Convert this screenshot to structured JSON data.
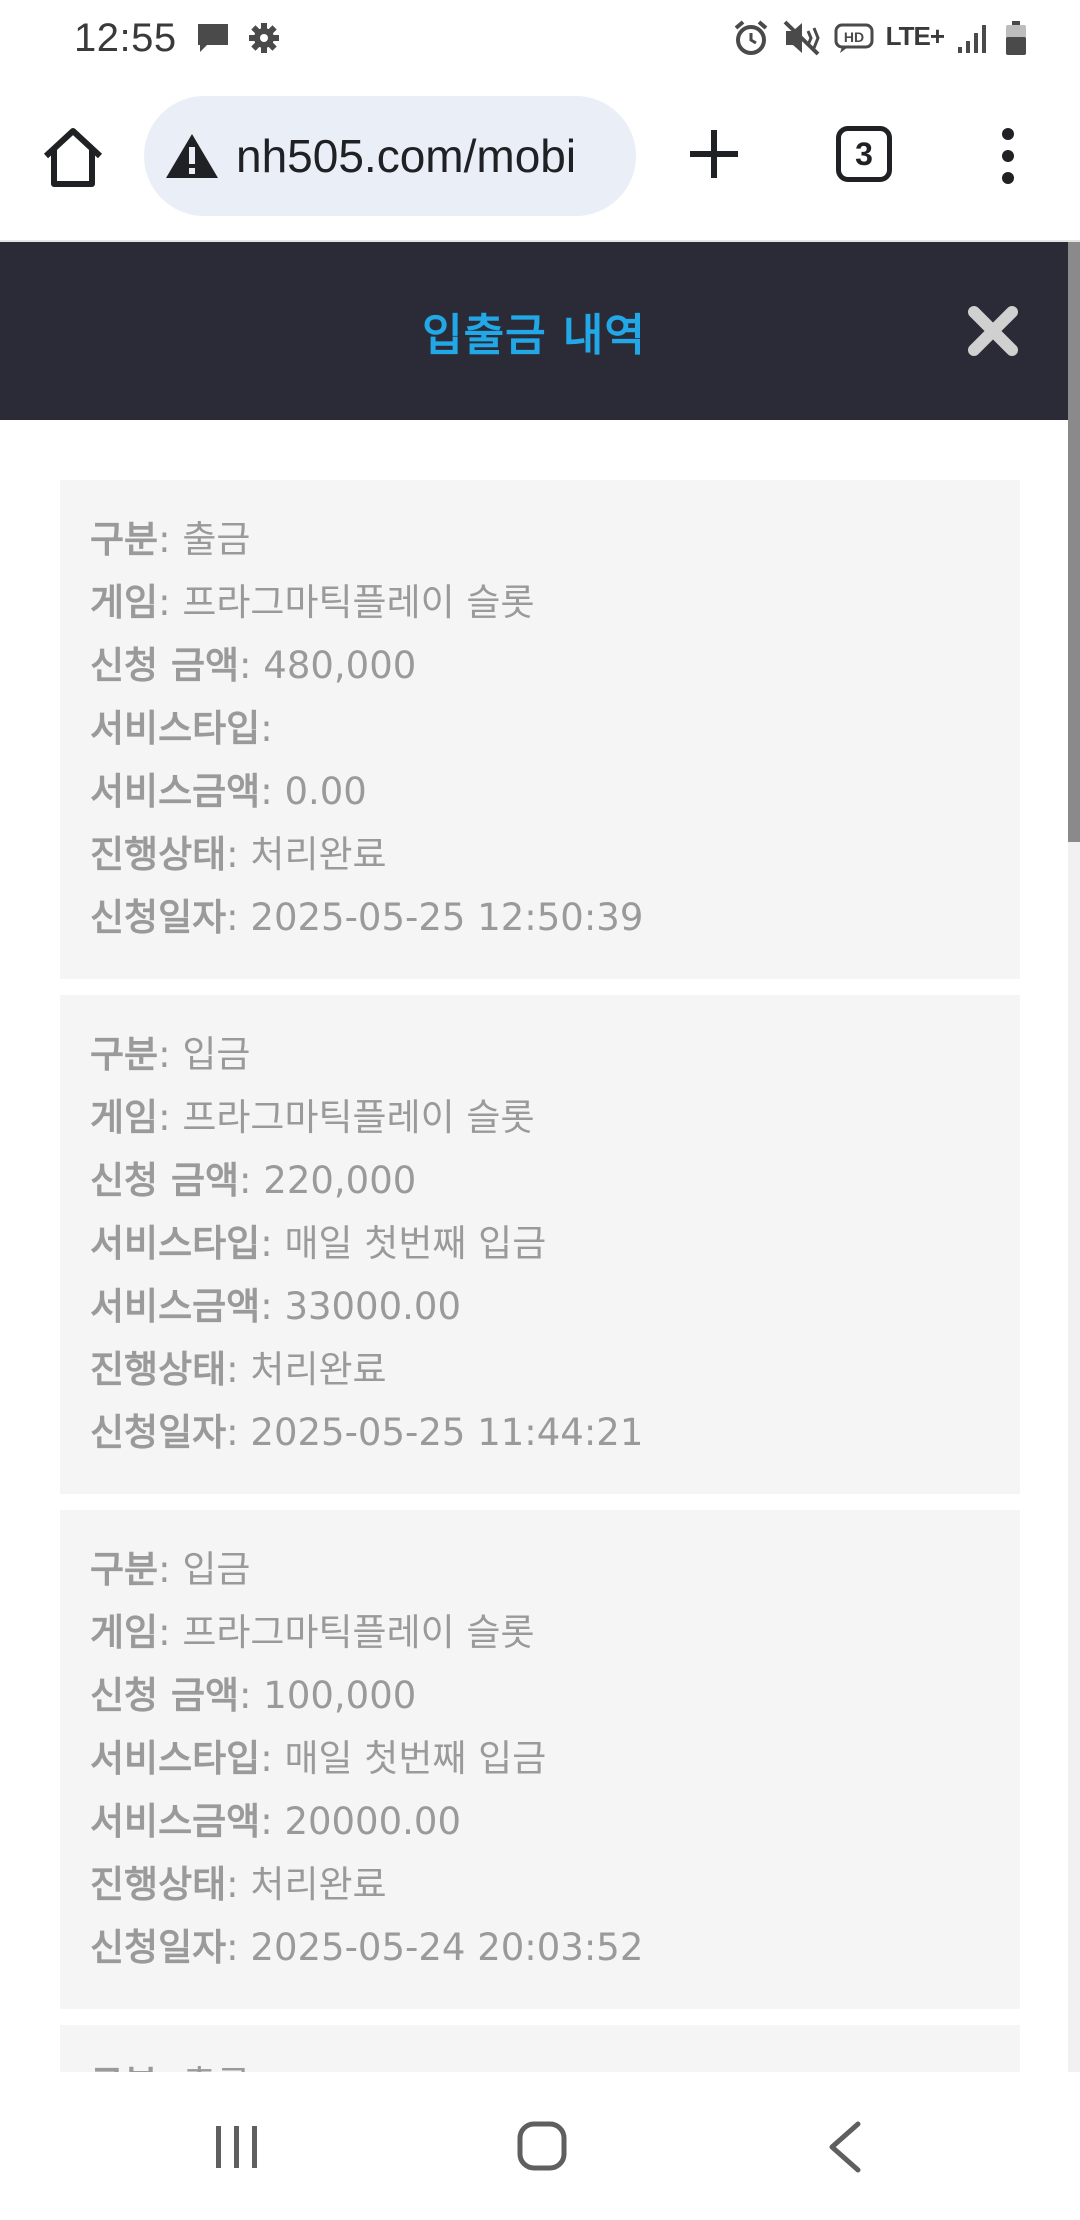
{
  "status_bar": {
    "time": "12:55",
    "network_label": "LTE+"
  },
  "browser": {
    "url": "nh505.com/mobi",
    "tab_count": "3"
  },
  "page": {
    "title": "입출금 내역"
  },
  "labels": {
    "type": "구분",
    "game": "게임",
    "amount": "신청 금액",
    "service_type": "서비스타입",
    "service_amount": "서비스금액",
    "status": "진행상태",
    "date": "신청일자"
  },
  "records": [
    {
      "type": "출금",
      "game": "프라그마틱플레이 슬롯",
      "amount": "480,000",
      "service_type": "",
      "service_amount": "0.00",
      "status": "처리완료",
      "date": "2025-05-25 12:50:39"
    },
    {
      "type": "입금",
      "game": "프라그마틱플레이 슬롯",
      "amount": "220,000",
      "service_type": "매일 첫번째 입금",
      "service_amount": "33000.00",
      "status": "처리완료",
      "date": "2025-05-25 11:44:21"
    },
    {
      "type": "입금",
      "game": "프라그마틱플레이 슬롯",
      "amount": "100,000",
      "service_type": "매일 첫번째 입금",
      "service_amount": "20000.00",
      "status": "처리완료",
      "date": "2025-05-24 20:03:52"
    },
    {
      "type": "출금",
      "game": "",
      "amount": "",
      "service_type": "",
      "service_amount": "",
      "status": "",
      "date": ""
    }
  ],
  "colors": {
    "header_bg": "#2b2b37",
    "title": "#22a8e6",
    "card_bg": "#f5f5f5",
    "card_text": "#9a9a9a"
  }
}
